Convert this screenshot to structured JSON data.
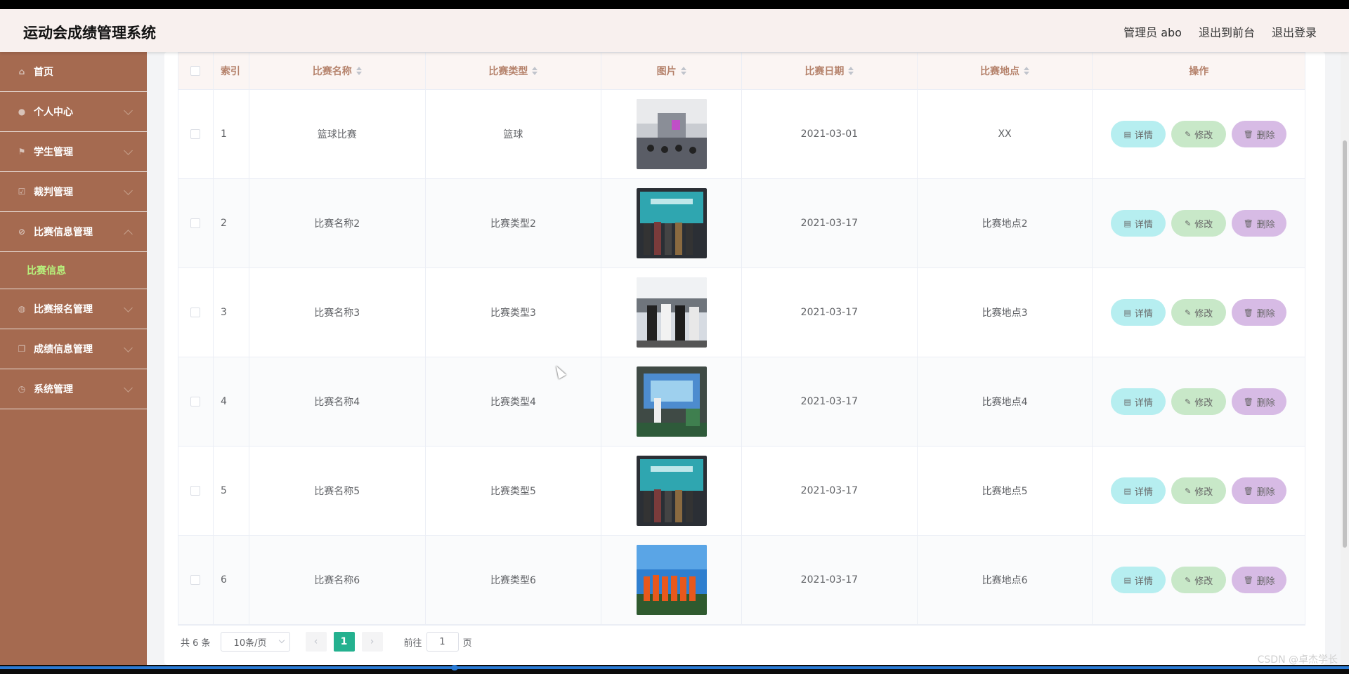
{
  "header": {
    "title": "运动会成绩管理系统",
    "admin_label": "管理员 abo",
    "to_front_label": "退出到前台",
    "logout_label": "退出登录"
  },
  "sidebar": {
    "items": [
      {
        "label": "首页",
        "icon": "home-icon"
      },
      {
        "label": "个人中心",
        "icon": "user-icon"
      },
      {
        "label": "学生管理",
        "icon": "flag-icon"
      },
      {
        "label": "裁判管理",
        "icon": "check-icon"
      },
      {
        "label": "比赛信息管理",
        "icon": "compass-icon",
        "expanded": true,
        "sub": [
          {
            "label": "比赛信息"
          }
        ]
      },
      {
        "label": "比赛报名管理",
        "icon": "globe-icon"
      },
      {
        "label": "成绩信息管理",
        "icon": "copy-icon"
      },
      {
        "label": "系统管理",
        "icon": "clock-icon"
      }
    ]
  },
  "table": {
    "columns": [
      "索引",
      "比赛名称",
      "比赛类型",
      "图片",
      "比赛日期",
      "比赛地点",
      "操作"
    ],
    "rows": [
      {
        "index": "1",
        "name": "篮球比赛",
        "type": "篮球",
        "date": "2021-03-01",
        "place": "XX"
      },
      {
        "index": "2",
        "name": "比赛名称2",
        "type": "比赛类型2",
        "date": "2021-03-17",
        "place": "比赛地点2"
      },
      {
        "index": "3",
        "name": "比赛名称3",
        "type": "比赛类型3",
        "date": "2021-03-17",
        "place": "比赛地点3"
      },
      {
        "index": "4",
        "name": "比赛名称4",
        "type": "比赛类型4",
        "date": "2021-03-17",
        "place": "比赛地点4"
      },
      {
        "index": "5",
        "name": "比赛名称5",
        "type": "比赛类型5",
        "date": "2021-03-17",
        "place": "比赛地点5"
      },
      {
        "index": "6",
        "name": "比赛名称6",
        "type": "比赛类型6",
        "date": "2021-03-17",
        "place": "比赛地点6"
      }
    ],
    "actions": {
      "detail": "详情",
      "edit": "修改",
      "delete": "删除"
    }
  },
  "pagination": {
    "total": "共 6 条",
    "page_size": "10条/页",
    "prev": "‹",
    "next": "›",
    "current_page": "1",
    "goto_label": "前往",
    "goto_value": "1",
    "page_suffix": "页"
  },
  "watermark": "CSDN @卓杰学长",
  "colors": {
    "sidebar": "#a56a50",
    "active_submenu": "#b7f27c",
    "page_active": "#24b18f",
    "detail_button": "#b6eef0",
    "edit_button": "#c8e8c8",
    "delete_button": "#d7bbe5"
  }
}
